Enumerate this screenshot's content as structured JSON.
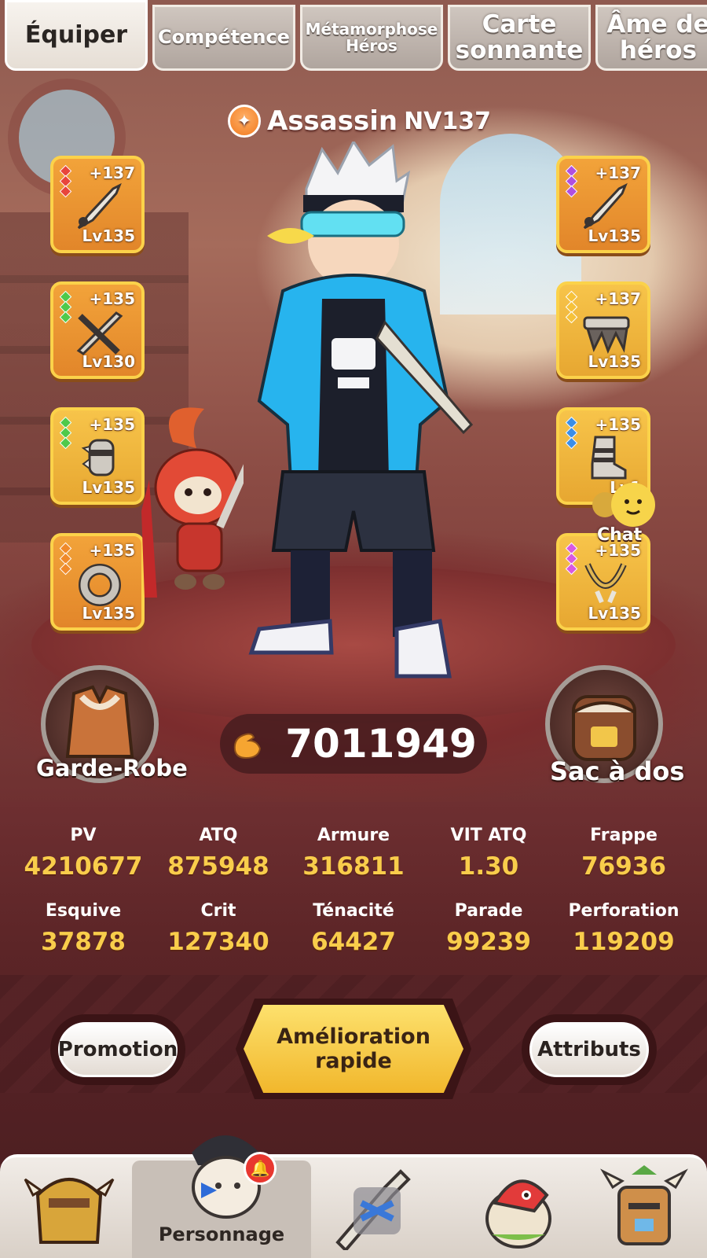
{
  "tabs": [
    {
      "label": "Équiper",
      "active": true
    },
    {
      "label": "Compétence",
      "active": false
    },
    {
      "label": "Métamorphose Héros",
      "active": false
    },
    {
      "label": "Carte sonnante",
      "active": false
    },
    {
      "label": "Âme de héros",
      "active": false
    }
  ],
  "hero": {
    "class_name": "Assassin",
    "level": "NV137",
    "class_icon": "assassin-class-icon"
  },
  "equipment": {
    "left": [
      {
        "plus": "+137",
        "level": "Lv135",
        "item": "dagger-icon",
        "gem_color": "#e8453c"
      },
      {
        "plus": "+135",
        "level": "Lv130",
        "item": "crossed-blades-icon",
        "gem_color": "#4fc94a"
      },
      {
        "plus": "+135",
        "level": "Lv135",
        "item": "spiked-gauntlet-icon",
        "gem_color": "#4fc94a"
      },
      {
        "plus": "+135",
        "level": "Lv135",
        "item": "ring-icon",
        "gem_color": "#f08a2a"
      }
    ],
    "right": [
      {
        "plus": "+137",
        "level": "Lv135",
        "item": "dagger-icon",
        "gem_color": "#b04fe0"
      },
      {
        "plus": "+137",
        "level": "Lv135",
        "item": "belt-icon",
        "gem_color": "#f6c23a"
      },
      {
        "plus": "+135",
        "level": "Lv1",
        "item": "boots-icon",
        "gem_color": "#3a8ee8"
      },
      {
        "plus": "+135",
        "level": "Lv135",
        "item": "necklace-icon",
        "gem_color": "#d85ae0"
      }
    ]
  },
  "chat": {
    "label": "Chat"
  },
  "wardrobe": {
    "label": "Garde-Robe"
  },
  "backpack": {
    "label": "Sac à dos"
  },
  "power": {
    "value": "7011949",
    "icon": "muscle-icon"
  },
  "stats": [
    [
      {
        "label": "PV",
        "value": "4210677"
      },
      {
        "label": "ATQ",
        "value": "875948"
      },
      {
        "label": "Armure",
        "value": "316811"
      },
      {
        "label": "VIT ATQ",
        "value": "1.30"
      },
      {
        "label": "Frappe",
        "value": "76936"
      }
    ],
    [
      {
        "label": "Esquive",
        "value": "37878"
      },
      {
        "label": "Crit",
        "value": "127340"
      },
      {
        "label": "Ténacité",
        "value": "64427"
      },
      {
        "label": "Parade",
        "value": "99239"
      },
      {
        "label": "Perforation",
        "value": "119209"
      }
    ]
  ],
  "actions": {
    "promotion": "Promotion",
    "quick_upgrade": "Amélioration rapide",
    "attributes": "Attributs"
  },
  "nav": {
    "active_label": "Personnage",
    "notification_icon": "bell-icon"
  }
}
